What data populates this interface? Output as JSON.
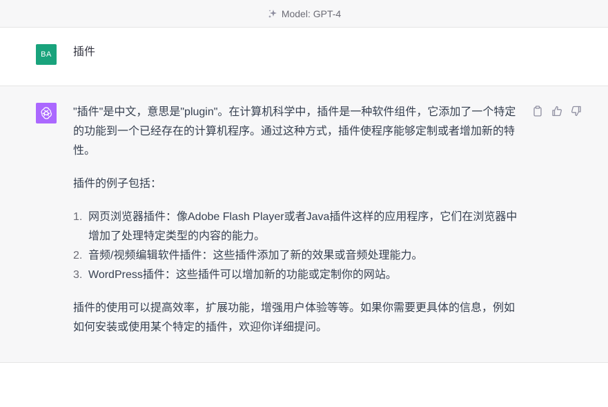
{
  "header": {
    "model_label": "Model: GPT-4",
    "icon": "sparkle-icon"
  },
  "user_message": {
    "avatar_initials": "BA",
    "avatar_color": "#19a37c",
    "text": "插件"
  },
  "assistant_message": {
    "avatar_icon": "openai-logo-icon",
    "avatar_color": "#ab68ff",
    "paragraphs": [
      "\"插件\"是中文，意思是\"plugin\"。在计算机科学中，插件是一种软件组件，它添加了一个特定的功能到一个已经存在的计算机程序。通过这种方式，插件使程序能够定制或者增加新的特性。",
      "插件的例子包括："
    ],
    "list": [
      {
        "num": "1.",
        "text": "网页浏览器插件：像Adobe Flash Player或者Java插件这样的应用程序，它们在浏览器中增加了处理特定类型的内容的能力。"
      },
      {
        "num": "2.",
        "text": "音频/视频编辑软件插件：这些插件添加了新的效果或音频处理能力。"
      },
      {
        "num": "3.",
        "text": "WordPress插件：这些插件可以增加新的功能或定制你的网站。"
      }
    ],
    "closing": "插件的使用可以提高效率，扩展功能，增强用户体验等等。如果你需要更具体的信息，例如如何安装或使用某个特定的插件，欢迎你详细提问。",
    "actions": [
      "copy-icon",
      "thumbs-up-icon",
      "thumbs-down-icon"
    ]
  }
}
